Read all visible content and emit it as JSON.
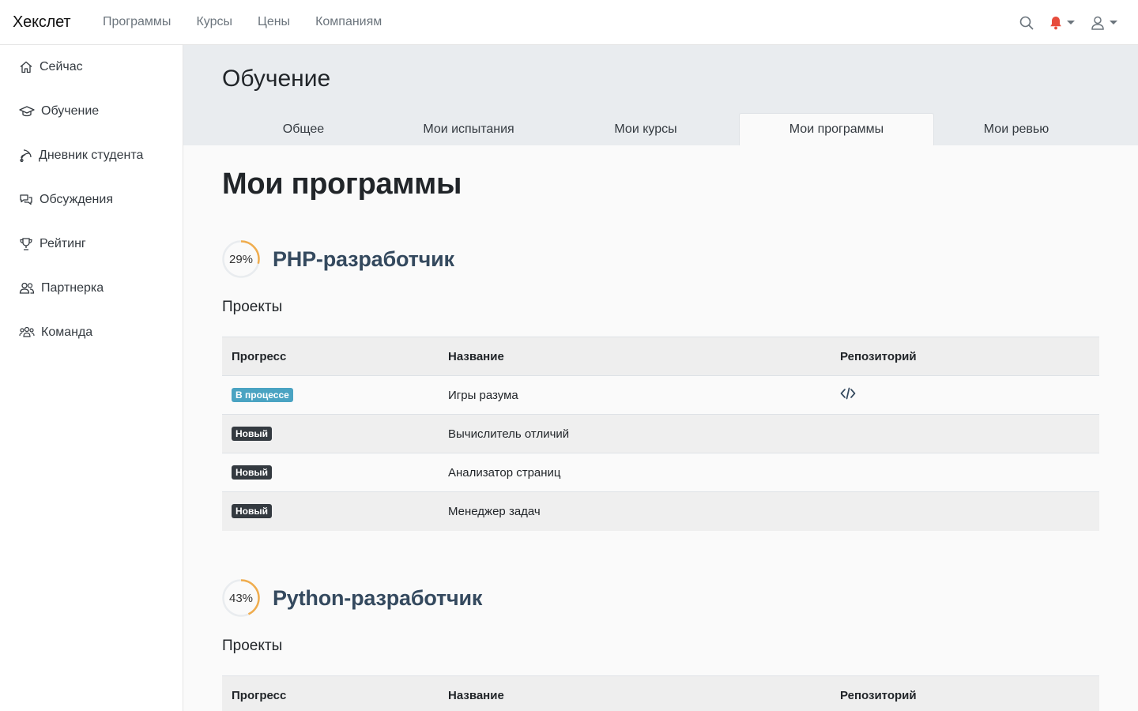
{
  "brand": "Хекслет",
  "topnav": [
    "Программы",
    "Курсы",
    "Цены",
    "Компаниям"
  ],
  "icons": {
    "search": "search-icon",
    "bell": "bell-icon",
    "user": "user-icon"
  },
  "colors": {
    "bell": "#e74c3c",
    "ring_track": "#e9ecef",
    "ring_progress": "#f0ad4e",
    "badge_progress": "#4aa3c2",
    "badge_new": "#343a40"
  },
  "sidebar": {
    "items": [
      {
        "label": "Сейчас",
        "icon": "home-icon"
      },
      {
        "label": "Обучение",
        "icon": "graduation-cap-icon"
      },
      {
        "label": "Дневник студента",
        "icon": "satellite-icon"
      },
      {
        "label": "Обсуждения",
        "icon": "chat-icon"
      },
      {
        "label": "Рейтинг",
        "icon": "trophy-icon"
      },
      {
        "label": "Партнерка",
        "icon": "users-icon"
      },
      {
        "label": "Команда",
        "icon": "team-icon"
      }
    ]
  },
  "page": {
    "title": "Обучение",
    "tabs": [
      "Общее",
      "Мои испытания",
      "Мои курсы",
      "Мои программы",
      "Мои ревью"
    ],
    "active_tab": "Мои программы",
    "heading": "Мои программы"
  },
  "table_headers": {
    "progress": "Прогресс",
    "name": "Название",
    "repo": "Репозиторий"
  },
  "programs": [
    {
      "percent": "29%",
      "progress": 0.29,
      "title": "PHP-разработчик",
      "section": "Проекты",
      "rows": [
        {
          "status": "В процессе",
          "status_type": "progress",
          "name": "Игры разума",
          "repo": true
        },
        {
          "status": "Новый",
          "status_type": "new",
          "name": "Вычислитель отличий",
          "repo": false
        },
        {
          "status": "Новый",
          "status_type": "new",
          "name": "Анализатор страниц",
          "repo": false
        },
        {
          "status": "Новый",
          "status_type": "new",
          "name": "Менеджер задач",
          "repo": false
        }
      ]
    },
    {
      "percent": "43%",
      "progress": 0.43,
      "title": "Python-разработчик",
      "section": "Проекты",
      "rows": []
    }
  ]
}
